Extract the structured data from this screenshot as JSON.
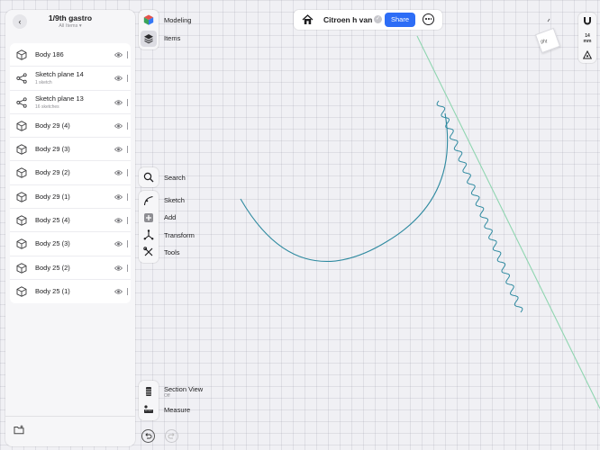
{
  "sidebar": {
    "title": "1/9th gastro",
    "subtitle": "All Items ▾",
    "items": [
      {
        "label": "Body 186",
        "icon": "cube-icon",
        "detail": ""
      },
      {
        "label": "Sketch plane 14",
        "icon": "sketch-plane-icon",
        "detail": "1 sketch"
      },
      {
        "label": "Sketch plane 13",
        "icon": "sketch-plane-icon",
        "detail": "16 sketches"
      },
      {
        "label": "Body 29 (4)",
        "icon": "cube-icon",
        "detail": ""
      },
      {
        "label": "Body 29 (3)",
        "icon": "cube-icon",
        "detail": ""
      },
      {
        "label": "Body 29 (2)",
        "icon": "cube-icon",
        "detail": ""
      },
      {
        "label": "Body 29 (1)",
        "icon": "cube-icon",
        "detail": ""
      },
      {
        "label": "Body 25 (4)",
        "icon": "cube-icon",
        "detail": ""
      },
      {
        "label": "Body 25 (3)",
        "icon": "cube-icon",
        "detail": ""
      },
      {
        "label": "Body 25 (2)",
        "icon": "cube-icon",
        "detail": ""
      },
      {
        "label": "Body 25 (1)",
        "icon": "cube-icon",
        "detail": ""
      }
    ]
  },
  "toolbar": {
    "modeling": "Modeling",
    "items": "Items",
    "search": "Search",
    "sketch": "Sketch",
    "add": "Add",
    "transform": "Transform",
    "tools": "Tools",
    "section_view": "Section View",
    "section_view_state": "Off",
    "measure": "Measure"
  },
  "topbar": {
    "title": "Citroen h van",
    "share": "Share"
  },
  "view_cube": {
    "label": "ght"
  },
  "right_tools": {
    "scale_value": "14",
    "scale_unit": "mm"
  },
  "colors": {
    "accent": "#2d6df6",
    "sketch_curve": "#2f8aa0",
    "axis_line": "#8fd5b0"
  }
}
